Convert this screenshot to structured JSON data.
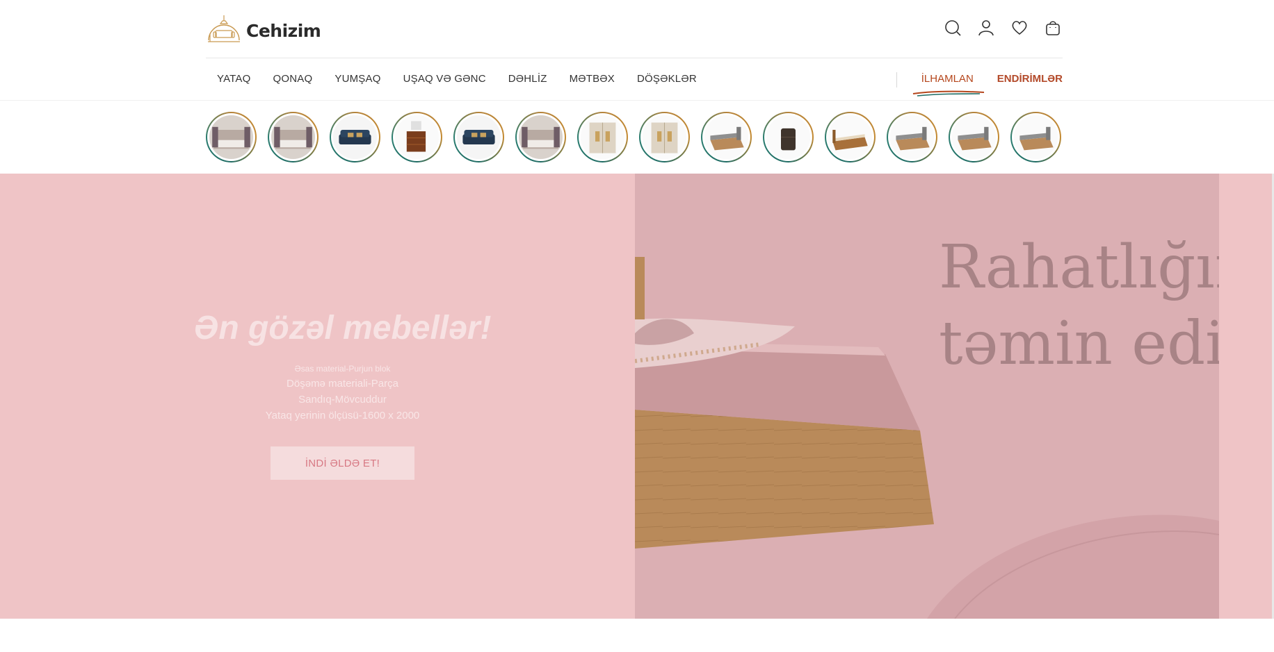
{
  "brand": {
    "name": "Cehizim"
  },
  "header_icons": [
    "search-icon",
    "user-icon",
    "heart-icon",
    "bag-icon"
  ],
  "nav": {
    "items": [
      {
        "label": "YATAQ"
      },
      {
        "label": "QONAQ"
      },
      {
        "label": "YUMŞAQ"
      },
      {
        "label": "UŞAQ VƏ GƏNC"
      },
      {
        "label": "DƏHLİZ"
      },
      {
        "label": "MƏTBƏX"
      },
      {
        "label": "DÖŞƏKLƏR"
      }
    ],
    "special": {
      "inspire": "İLHAMLAN",
      "discounts": "ENDİRİMLƏR"
    }
  },
  "stories": [
    {
      "kind": "bedroom"
    },
    {
      "kind": "bedroom"
    },
    {
      "kind": "sofa"
    },
    {
      "kind": "dresser"
    },
    {
      "kind": "sofa"
    },
    {
      "kind": "bedroom"
    },
    {
      "kind": "wardrobe"
    },
    {
      "kind": "wardrobe"
    },
    {
      "kind": "bed"
    },
    {
      "kind": "cabinet"
    },
    {
      "kind": "bed-wood"
    },
    {
      "kind": "bed"
    },
    {
      "kind": "bed"
    },
    {
      "kind": "bed"
    }
  ],
  "hero": {
    "title": "Ən gözəl mebellər!",
    "details": [
      "Əsas material-Purjun blok",
      "Döşəmə materiali-Parça",
      "Sandıq-Mövcuddur",
      "Yataq yerinin ölçüsü-1600 x 2000"
    ],
    "button": "İNDİ ƏLDƏ ET!",
    "image_text_line1": "Rahatlığın",
    "image_text_line2": "təmin edin"
  },
  "colors": {
    "hero_bg": "#efc4c6",
    "accent": "#b34a2a",
    "ring_gold": "#b5833a",
    "ring_teal": "#1e6b63"
  }
}
